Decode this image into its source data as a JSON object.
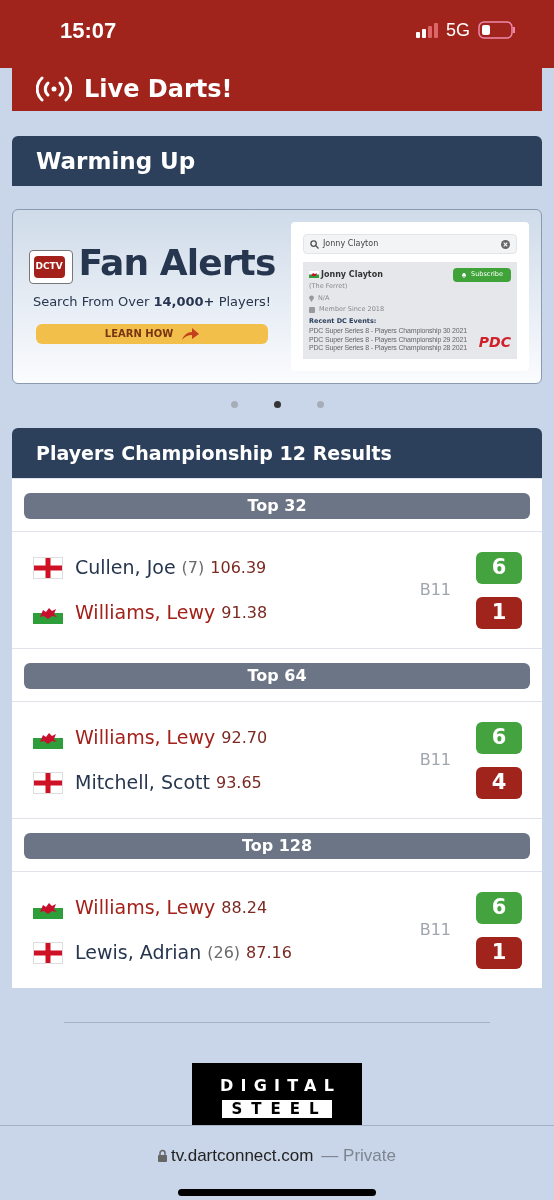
{
  "status_bar": {
    "time": "15:07",
    "network": "5G"
  },
  "live_banner": {
    "title": "Live Darts!"
  },
  "warming_up": {
    "title": "Warming Up"
  },
  "ad": {
    "badge": "DCTV",
    "title": "Fan Alerts",
    "subtitle": "Search From Over **14,000+** Players!",
    "button": "LEARN HOW",
    "search_value": "Jonny Clayton",
    "player": {
      "name": "Jonny Clayton",
      "nickname": "(The Ferret)",
      "location": "N/A",
      "member": "Member Since 2018",
      "events_title": "Recent DC Events:",
      "events": [
        "PDC Super Series 8 - Players Championship 30 2021",
        "PDC Super Series 8 - Players Championship 29 2021",
        "PDC Super Series 8 - Players Championship 28 2021"
      ]
    },
    "subscribe": "Subscribe",
    "logo": "PDC"
  },
  "carousel": [
    {
      "selected": false
    },
    {
      "selected": true
    },
    {
      "selected": false
    }
  ],
  "results": {
    "title": "Players Championship 12 Results",
    "rounds": [
      {
        "label": "Top 32",
        "board": "B11",
        "players": [
          {
            "kind": "england",
            "name": "Cullen, Joe",
            "seed": "(7)",
            "average": "106.39",
            "followed": false,
            "score": "6",
            "won": true
          },
          {
            "kind": "wales",
            "name": "Williams, Lewy",
            "average": "91.38",
            "followed": true,
            "score": "1",
            "won": false
          }
        ]
      },
      {
        "label": "Top 64",
        "board": "B11",
        "players": [
          {
            "kind": "wales",
            "name": "Williams, Lewy",
            "average": "92.70",
            "followed": true,
            "score": "6",
            "won": true
          },
          {
            "kind": "england",
            "name": "Mitchell, Scott",
            "average": "93.65",
            "followed": false,
            "score": "4",
            "won": false
          }
        ]
      },
      {
        "label": "Top 128",
        "board": "B11",
        "players": [
          {
            "kind": "wales",
            "name": "Williams, Lewy",
            "average": "88.24",
            "followed": true,
            "score": "6",
            "won": true
          },
          {
            "kind": "england",
            "name": "Lewis, Adrian",
            "seed": "(26)",
            "average": "87.16",
            "followed": false,
            "score": "1",
            "won": false
          }
        ]
      }
    ]
  },
  "sponsor": {
    "line_1": "DIGITAL",
    "line_2": "STEEL"
  },
  "address_bar": {
    "url": "tv.dartconnect.com",
    "mode": "— Private"
  }
}
